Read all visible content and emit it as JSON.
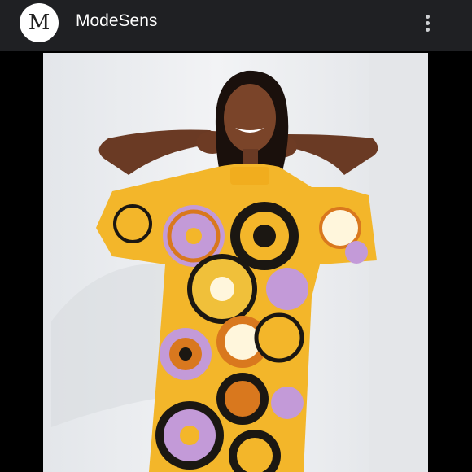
{
  "header": {
    "avatar_letter": "M",
    "title": "ModeSens",
    "menu_icon": "more-vert-icon"
  },
  "photo": {
    "subject": "model-in-printed-dress",
    "colors": {
      "background": "#e9ebee",
      "dress_yellow": "#f3b62a",
      "dress_orange": "#d9781e",
      "dress_lilac": "#c39ad8",
      "dress_black": "#1b1712",
      "skin": "#6a3a24",
      "hair": "#1a100c"
    }
  }
}
